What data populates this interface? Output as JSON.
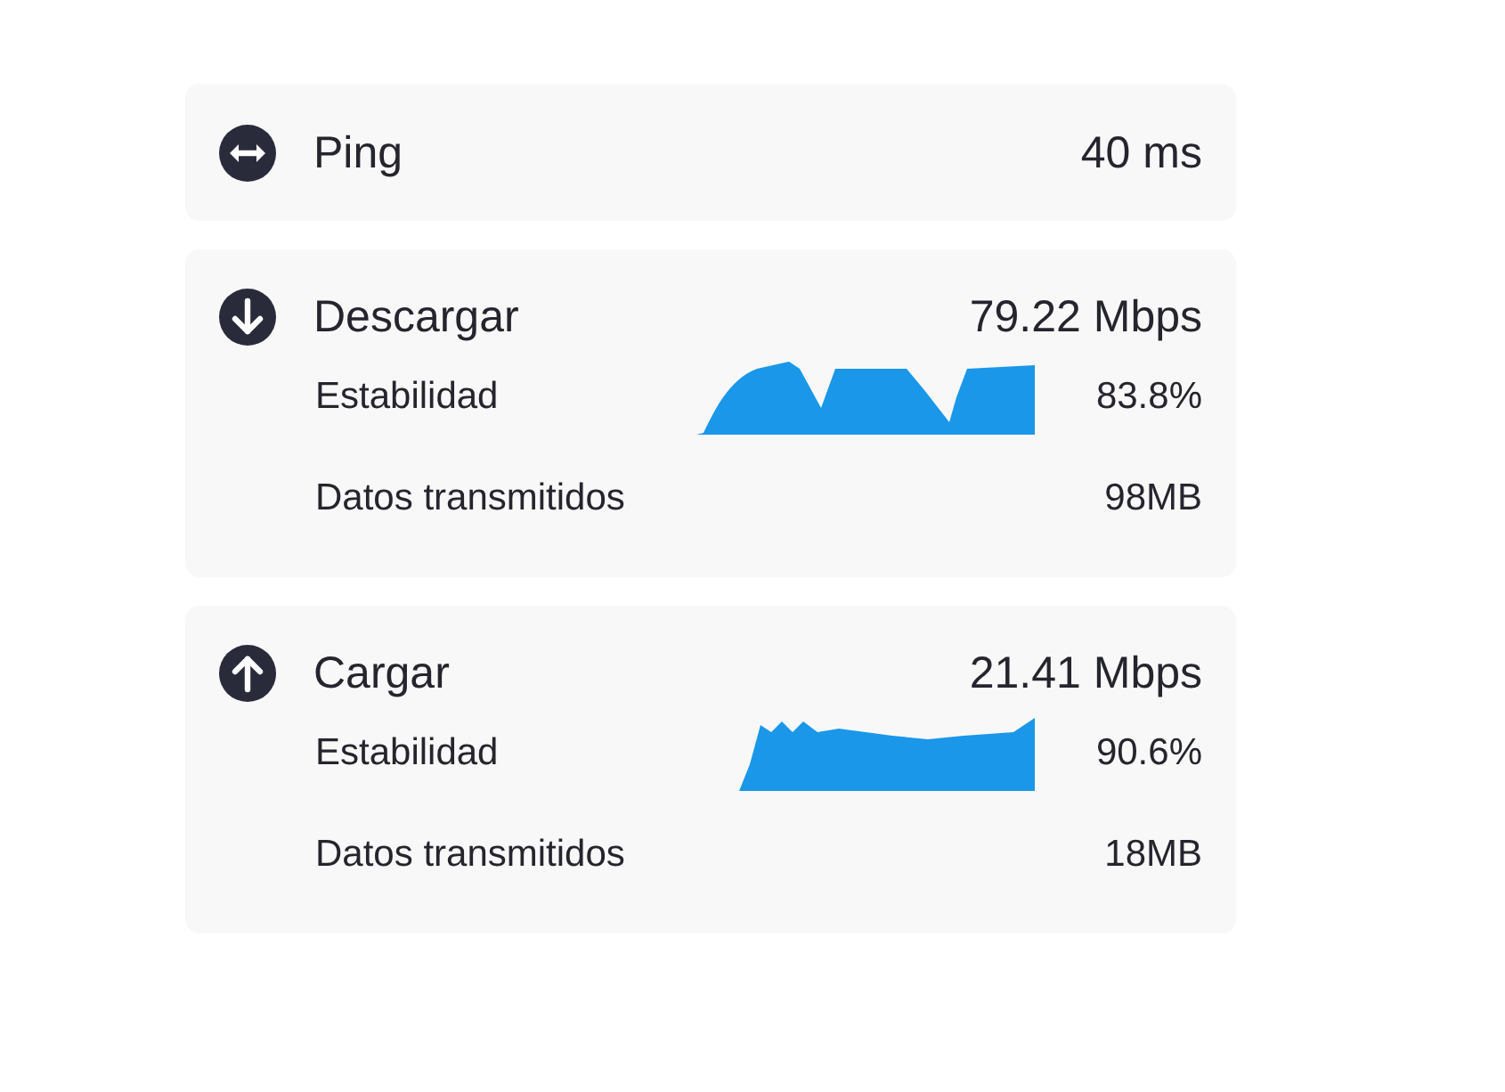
{
  "cards": [
    {
      "kind": "ping",
      "title": "Ping",
      "value": "40 ms"
    },
    {
      "kind": "download",
      "title": "Descargar",
      "value": "79.22 Mbps",
      "stability_label": "Estabilidad",
      "stability": "83.8%",
      "data_label": "Datos transmitidos",
      "data": "98MB"
    },
    {
      "kind": "upload",
      "title": "Cargar",
      "value": "21.41 Mbps",
      "stability_label": "Estabilidad",
      "stability": "90.6%",
      "data_label": "Datos transmitidos",
      "data": "18MB"
    }
  ]
}
